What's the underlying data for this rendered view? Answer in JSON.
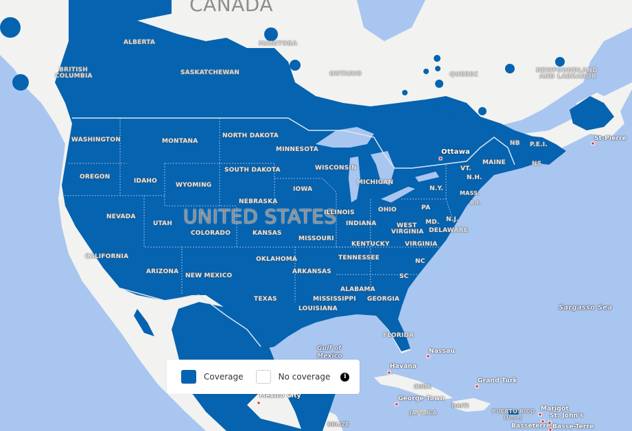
{
  "map": {
    "colors": {
      "water": "#a9c6f0",
      "land": "#f2f2f0",
      "coverage": "#0563b0",
      "city_marker": "#e02020"
    },
    "country_labels": {
      "canada": "CANADA",
      "united_states": "UNITED STATES",
      "cuba": "CUBA",
      "haiti": "HAITI",
      "jamaica": "JAMAICA",
      "belize": "BELIZE",
      "puerto_rico": "PUERTO RICO",
      "puerto_rico_sub": "(U.S.)"
    },
    "province_labels": {
      "alberta": "ALBERTA",
      "british_columbia_1": "BRITISH",
      "british_columbia_2": "COLUMBIA",
      "saskatchewan": "SASKATCHEWAN",
      "manitoba": "MANITOBA",
      "ontario": "ONTARIO",
      "quebec": "QUEBEC",
      "newfoundland_1": "NEWFOUNDLAND",
      "newfoundland_2": "AND LABRADOR",
      "nb": "NB",
      "pei": "P.E.I.",
      "ns": "NS"
    },
    "state_labels": {
      "washington": "WASHINGTON",
      "oregon": "OREGON",
      "california": "CALIFORNIA",
      "nevada": "NEVADA",
      "idaho": "IDAHO",
      "montana": "MONTANA",
      "wyoming": "WYOMING",
      "utah": "UTAH",
      "arizona": "ARIZONA",
      "colorado": "COLORADO",
      "new_mexico": "NEW MEXICO",
      "north_dakota": "NORTH DAKOTA",
      "south_dakota": "SOUTH DAKOTA",
      "nebraska": "NEBRASKA",
      "kansas": "KANSAS",
      "oklahoma": "OKLAHOMA",
      "texas": "TEXAS",
      "minnesota": "MINNESOTA",
      "iowa": "IOWA",
      "missouri": "MISSOURI",
      "arkansas": "ARKANSAS",
      "louisiana": "LOUISIANA",
      "wisconsin": "WISCONSIN",
      "illinois": "ILLINOIS",
      "michigan": "MICHIGAN",
      "indiana": "INDIANA",
      "ohio": "OHIO",
      "kentucky": "KENTUCKY",
      "tennessee": "TENNESSEE",
      "mississippi": "MISSISSIPPI",
      "alabama": "ALABAMA",
      "georgia": "GEORGIA",
      "florida": "FLORIDA",
      "sc": "SC",
      "nc": "NC",
      "virginia": "VIRGINIA",
      "west_virginia_1": "WEST",
      "west_virginia_2": "VIRGINIA",
      "pa": "PA",
      "ny": "N.Y.",
      "md": "MD.",
      "delaware": "DELAWARE",
      "nj": "N.J.",
      "vt": "VT.",
      "nh": "N.H.",
      "maine": "MAINE",
      "mass": "MASS.",
      "ri": "R.I."
    },
    "city_labels": {
      "ottawa": "Ottawa",
      "st_pierre": "St-Pierre",
      "havana": "Havana",
      "nassau": "Nassau",
      "grand_turk": "Grand Turk",
      "george_town": "George Town",
      "mexico_city": "Mexico City",
      "marigot": "Marigot",
      "st_johns": "St. John's",
      "basseterre": "Basseterre",
      "basse_terre": "Basse-Terre"
    },
    "water_labels": {
      "gulf_of_mexico_1": "Gulf of",
      "gulf_of_mexico_2": "Mexico",
      "sargasso_sea": "Sargasso Sea"
    }
  },
  "legend": {
    "coverage_label": "Coverage",
    "no_coverage_label": "No coverage",
    "info_icon": "info-icon"
  }
}
